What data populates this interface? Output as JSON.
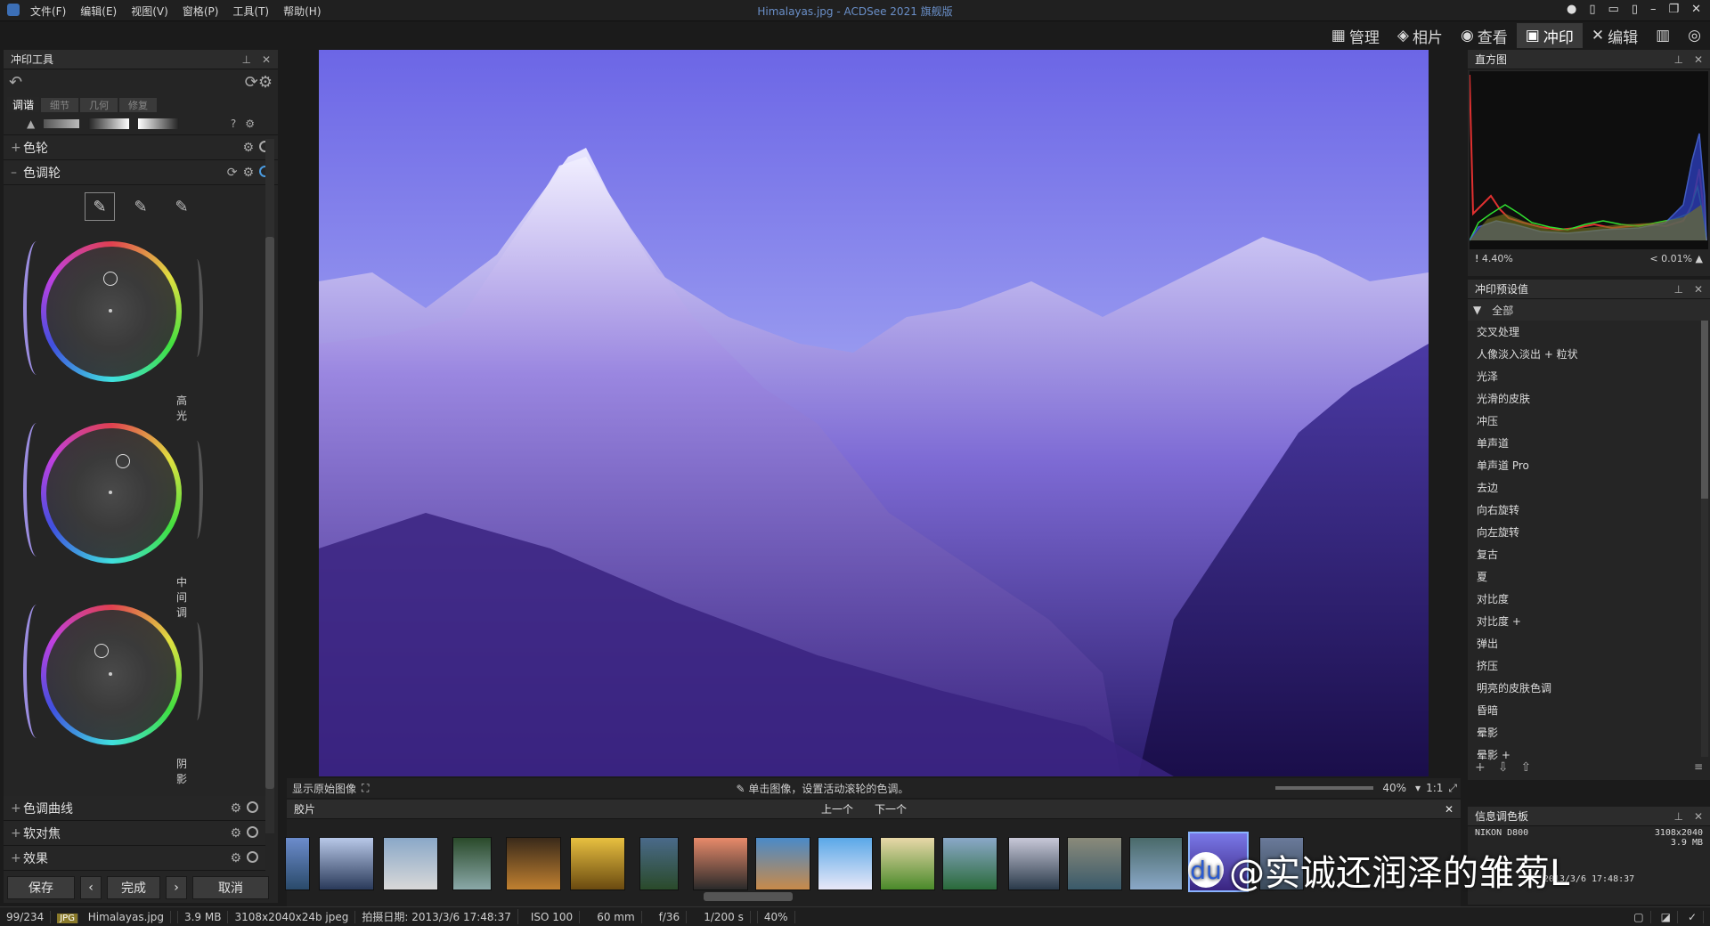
{
  "window": {
    "title": "Himalayas.jpg - ACDSee 2021 旗舰版"
  },
  "menu": [
    "文件(F)",
    "编辑(E)",
    "视图(V)",
    "窗格(P)",
    "工具(T)",
    "帮助(H)"
  ],
  "modes": [
    {
      "label": "管理"
    },
    {
      "label": "相片"
    },
    {
      "label": "查看"
    },
    {
      "label": "冲印",
      "active": true
    },
    {
      "label": "编辑"
    }
  ],
  "left": {
    "title": "冲印工具",
    "tabs": [
      "调谐",
      "细节",
      "几何",
      "修复"
    ],
    "sections": {
      "color_wheel": "色轮",
      "tone_wheels": "色调轮",
      "tone_curves": "色调曲线",
      "soft_focus": "软对焦",
      "effects": "效果"
    },
    "wheels": [
      "高光",
      "中间调",
      "阴影"
    ],
    "buttons": {
      "save": "保存",
      "done": "完成",
      "cancel": "取消"
    }
  },
  "viewer": {
    "show_original": "显示原始图像",
    "hint": "单击图像，设置活动滚轮的色调。",
    "zoom": "40%",
    "ratio": "1:1"
  },
  "filmstrip": {
    "title": "胶片",
    "prev": "上一个",
    "next": "下一个"
  },
  "histogram": {
    "title": "直方图",
    "left_value": "4.40%",
    "right_value": "< 0.01%"
  },
  "presets": {
    "title": "冲印预设值",
    "filter": "全部",
    "items": [
      "交叉处理",
      "人像淡入淡出 + 粒状",
      "光泽",
      "光滑的皮肤",
      "冲压",
      "单声道",
      "单声道 Pro",
      "去边",
      "向右旋转",
      "向左旋转",
      "复古",
      "夏",
      "对比度",
      "对比度 +",
      "弹出",
      "挤压",
      "明亮的皮肤色调",
      "昏暗",
      "晕影",
      "晕影 +"
    ]
  },
  "info": {
    "title": "信息调色板",
    "camera": "NIKON D800",
    "dims": "3108x2040",
    "size": "3.9 MB",
    "date": "2013/3/6 17:48:37"
  },
  "watermark": "@实诚还润泽的雏菊L",
  "status": {
    "index": "99/234",
    "type": "JPG",
    "file": "Himalayas.jpg",
    "size": "3.9 MB",
    "dims": "3108x2040x24b jpeg",
    "date": "拍摄日期: 2013/3/6 17:48:37",
    "iso": "ISO 100",
    "focal": "60 mm",
    "aperture": "f/36",
    "shutter": "1/200 s",
    "zoom": "40%"
  },
  "colors": {
    "accent": "#4a9be0",
    "sky": "#7a78e8",
    "mountain": "#5b3aa8"
  }
}
